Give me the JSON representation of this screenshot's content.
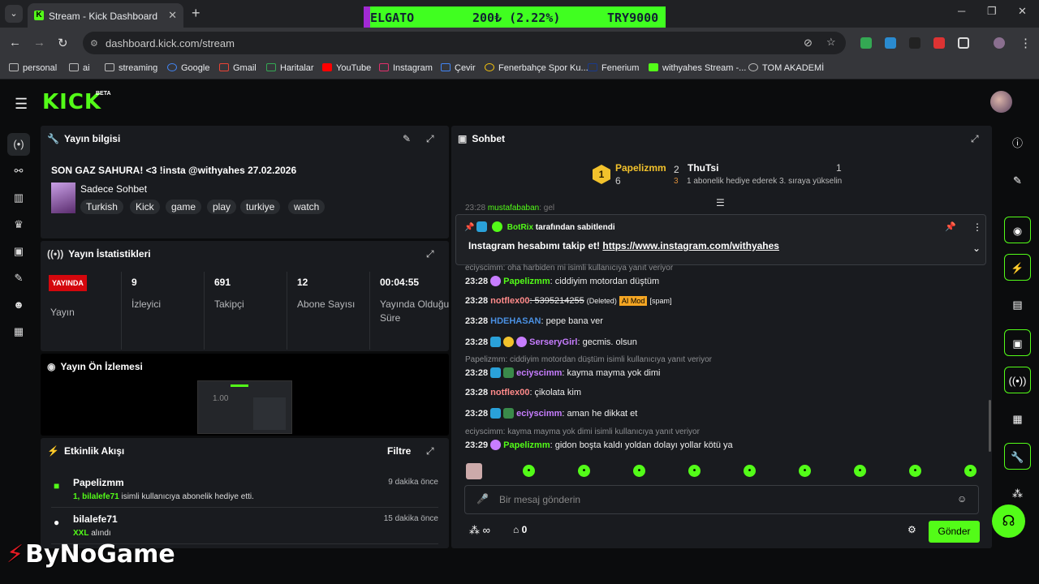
{
  "browser": {
    "tab_title": "Stream - Kick Dashboard",
    "url": "dashboard.kick.com/stream",
    "ticker": {
      "symbol": "ELGATO",
      "price": "200₺ (2.22%)",
      "pair": "TRY9000"
    },
    "bookmarks": [
      "personal",
      "ai",
      "streaming",
      "Google",
      "Gmail",
      "Haritalar",
      "YouTube",
      "Instagram",
      "Çevir",
      "Fenerbahçe Spor Ku...",
      "Fenerium",
      "withyahes Stream -...",
      "TOM AKADEMİ"
    ]
  },
  "app": {
    "logo": "KICK",
    "beta": "BETA"
  },
  "stream_info": {
    "header": "Yayın bilgisi",
    "title": "SON GAZ SAHURA! <3 !insta @withyahes 27.02.2026",
    "category": "Sadece Sohbet",
    "tags": [
      "Turkish",
      "Kick",
      "game",
      "play",
      "turkiye",
      "watch"
    ]
  },
  "stats": {
    "header": "Yayın İstatistikleri",
    "live_badge": "YAYINDA",
    "items": [
      {
        "value": "",
        "label": "Yayın"
      },
      {
        "value": "9",
        "label": "İzleyici"
      },
      {
        "value": "691",
        "label": "Takipçi"
      },
      {
        "value": "12",
        "label": "Abone Sayısı"
      },
      {
        "value": "00:04:55",
        "label": "Yayında Olduğu Süre"
      }
    ]
  },
  "preview": {
    "header": "Yayın Ön İzlemesi",
    "overlay": "1.00"
  },
  "activity": {
    "header": "Etkinlik Akışı",
    "filter": "Filtre",
    "items": [
      {
        "name": "Papelizmm",
        "time": "9 dakika önce",
        "highlight": "1, bilalefe71",
        "desc": " isimli kullanıcıya abonelik hediye etti."
      },
      {
        "name": "bilalefe71",
        "time": "15 dakika önce",
        "highlight": "XXL",
        "desc": " alındı"
      }
    ]
  },
  "chat": {
    "header": "Sohbet",
    "leaderboard": {
      "first": {
        "rank": "1",
        "name": "Papelizmm",
        "count": "6"
      },
      "second": {
        "rank": "2",
        "name": "ThuTsi",
        "count": "1"
      },
      "third": {
        "rank": "3",
        "text": "1 abonelik hediye ederek 3. sıraya yükselin"
      }
    },
    "cut_msg": {
      "time": "23:28",
      "user": "mustafababan",
      "text": ": gel"
    },
    "pinned": {
      "by": "BotRix",
      "by_suffix": " tarafından sabitlendi",
      "text": "Instagram hesabımı takip et! ",
      "link": "https://www.instagram.com/withyahes"
    },
    "messages": [
      {
        "reply": "eciyscimm: oha harbiden mi isimli kullanıcıya yanıt veriyor"
      },
      {
        "time": "23:28",
        "user": "Papelizmm",
        "color": "#53fc18",
        "text": ": ciddiyim motordan düştüm"
      },
      {
        "time": "23:28",
        "user": "notflex00",
        "color": "#ff8a8a",
        "text": ": 5395214255",
        "extra": "(Deleted)",
        "mod": "AI Mod",
        "spam": "[spam]"
      },
      {
        "time": "23:28",
        "user": "HDEHASAN",
        "color": "#4a90e2",
        "text": ": pepe bana ver"
      },
      {
        "time": "23:28",
        "user": "SerseryGirl",
        "color": "#c77dff",
        "text": ": gecmis. olsun"
      },
      {
        "reply": "Papelizmm: ciddiyim motordan düştüm isimli kullanıcıya yanıt veriyor"
      },
      {
        "time": "23:28",
        "user": "eciyscimm",
        "color": "#c77dff",
        "text": ": kayma mayma yok dimi"
      },
      {
        "time": "23:28",
        "user": "notflex00",
        "color": "#ff8a8a",
        "text": ": çikolata kim"
      },
      {
        "time": "23:28",
        "user": "eciyscimm",
        "color": "#c77dff",
        "text": ": aman he dikkat et"
      },
      {
        "reply": "eciyscimm: kayma mayma yok dimi isimli kullanıcıya yanıt veriyor"
      },
      {
        "time": "23:29",
        "user": "Papelizmm",
        "color": "#53fc18",
        "text": ": gidon boşta kaldı yoldan dolayı yollar kötü ya"
      }
    ],
    "input_placeholder": "Bir mesaj gönderin",
    "points": "∞",
    "store_count": "0",
    "send": "Gönder"
  },
  "watermark": "ByNoGame"
}
